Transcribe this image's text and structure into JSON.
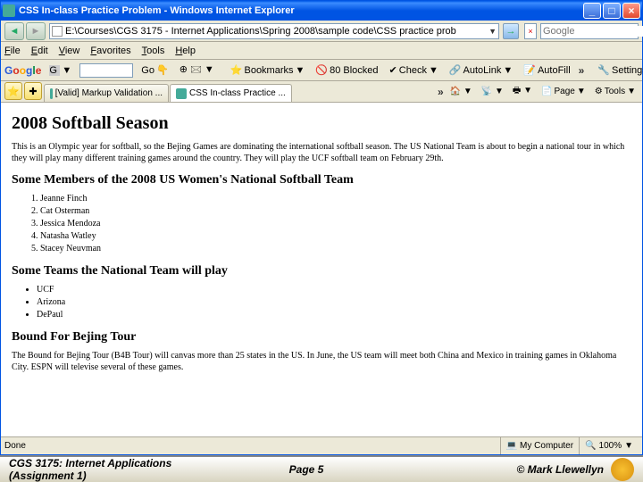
{
  "window": {
    "title": "CSS In-class Practice Problem - Windows Internet Explorer"
  },
  "address": {
    "url": "E:\\Courses\\CGS 3175 - Internet Applications\\Spring 2008\\sample code\\CSS practice prob"
  },
  "search": {
    "placeholder": "Google"
  },
  "menu": {
    "file": "File",
    "edit": "Edit",
    "view": "View",
    "favorites": "Favorites",
    "tools": "Tools",
    "help": "Help"
  },
  "google": {
    "go": "Go",
    "bookmarks": "Bookmarks",
    "blocked": "80 Blocked",
    "check": "Check",
    "autolink": "AutoLink",
    "autofill": "AutoFill",
    "settings": "Settings"
  },
  "tabs": {
    "t1": "[Valid] Markup Validation ...",
    "t2": "CSS In-class Practice ..."
  },
  "tabbtns": {
    "home": "",
    "print": "",
    "page": "Page",
    "tools": "Tools"
  },
  "page": {
    "h1": "2008 Softball Season",
    "p1": "This is an Olympic year for softball, so the Bejing Games are dominating the international softball season. The US National Team is about to begin a national tour in which they will play many different training games around the country. They will play the UCF softball team on February 29th.",
    "h2a": "Some Members of the 2008 US Women's National Softball Team",
    "m1": "Jeanne Finch",
    "m2": "Cat Osterman",
    "m3": "Jessica Mendoza",
    "m4": "Natasha Watley",
    "m5": "Stacey Neuvman",
    "h2b": "Some Teams the National Team will play",
    "t1": "UCF",
    "t2": "Arizona",
    "t3": "DePaul",
    "h2c": "Bound For Bejing Tour",
    "p2": "The Bound for Bejing Tour (B4B Tour) will canvas more than 25 states in the US. In June, the US team will meet both China and Mexico in training games in Oklahoma City. ESPN will televise several of these games."
  },
  "status": {
    "done": "Done",
    "zone": "My Computer",
    "zoom": "100%"
  },
  "footer": {
    "left": "CGS 3175: Internet Applications (Assignment 1)",
    "center": "Page 5",
    "right": "© Mark Llewellyn"
  }
}
